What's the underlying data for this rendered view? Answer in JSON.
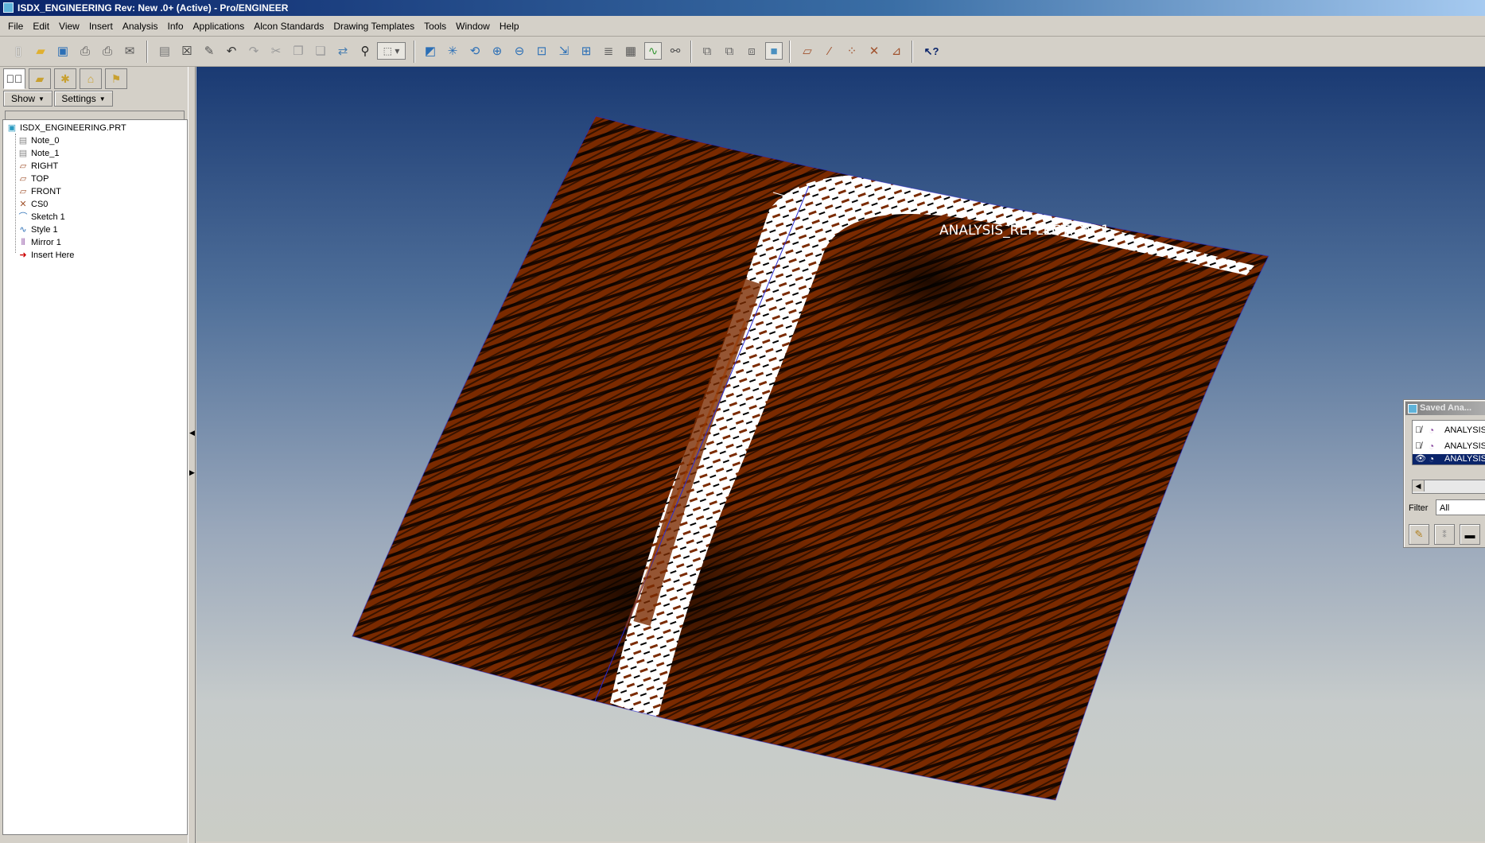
{
  "window": {
    "title": "ISDX_ENGINEERING Rev: New .0+  (Active) - Pro/ENGINEER"
  },
  "menu": [
    "File",
    "Edit",
    "View",
    "Insert",
    "Analysis",
    "Info",
    "Applications",
    "Alcon Standards",
    "Drawing Templates",
    "Tools",
    "Window",
    "Help"
  ],
  "toolbar_icons": [
    "new-file-icon",
    "open-folder-icon",
    "save-icon",
    "print-icon",
    "print-preview-icon",
    "send-mail-icon",
    "clipboard-icon",
    "close-window-icon",
    "regenerate-icon",
    "undo-icon",
    "redo-icon",
    "cut-icon",
    "copy-icon",
    "paste-icon",
    "paste-special-icon",
    "find-icon",
    "selection-box-icon",
    "repaint-icon",
    "spin-center-icon",
    "orient-mode-icon",
    "zoom-in-icon",
    "zoom-out-icon",
    "refit-icon",
    "reorient-icon",
    "saved-views-icon",
    "layers-icon",
    "view-manager-icon",
    "appearance-icon",
    "wireframe-icon",
    "hidden-line-icon",
    "no-hidden-icon",
    "shading-icon",
    "datum-planes-icon",
    "datum-axes-icon",
    "datum-points-icon",
    "coordinate-systems-icon",
    "annotations-icon",
    "context-help-icon"
  ],
  "nav": {
    "show_label": "Show",
    "settings_label": "Settings"
  },
  "model_tree": {
    "root": "ISDX_ENGINEERING.PRT",
    "items": [
      {
        "label": "Note_0",
        "icon": "note-icon"
      },
      {
        "label": "Note_1",
        "icon": "note-icon"
      },
      {
        "label": "RIGHT",
        "icon": "datum-plane-icon"
      },
      {
        "label": "TOP",
        "icon": "datum-plane-icon"
      },
      {
        "label": "FRONT",
        "icon": "datum-plane-icon"
      },
      {
        "label": "CS0",
        "icon": "coordinate-system-icon"
      },
      {
        "label": "Sketch 1",
        "icon": "sketch-icon"
      },
      {
        "label": "Style 1",
        "icon": "style-feature-icon"
      },
      {
        "label": "Mirror 1",
        "icon": "mirror-icon"
      },
      {
        "label": "Insert Here",
        "icon": "insert-here-arrow-icon"
      }
    ]
  },
  "graphics": {
    "analysis_label": "ANALYSIS_REFLECTION_1"
  },
  "saved_analyses": {
    "title": "Saved Ana...",
    "rows": [
      {
        "label": "ANALYSIS",
        "visible": false
      },
      {
        "label": "ANALYSIS",
        "visible": false
      },
      {
        "label": "ANALYSIS",
        "visible": true,
        "selected": true
      }
    ],
    "filter_label": "Filter",
    "filter_value": "All"
  },
  "colors": {
    "surface": "#7a2a00",
    "highlight": "#ffffff",
    "selection": "#0a246a"
  }
}
